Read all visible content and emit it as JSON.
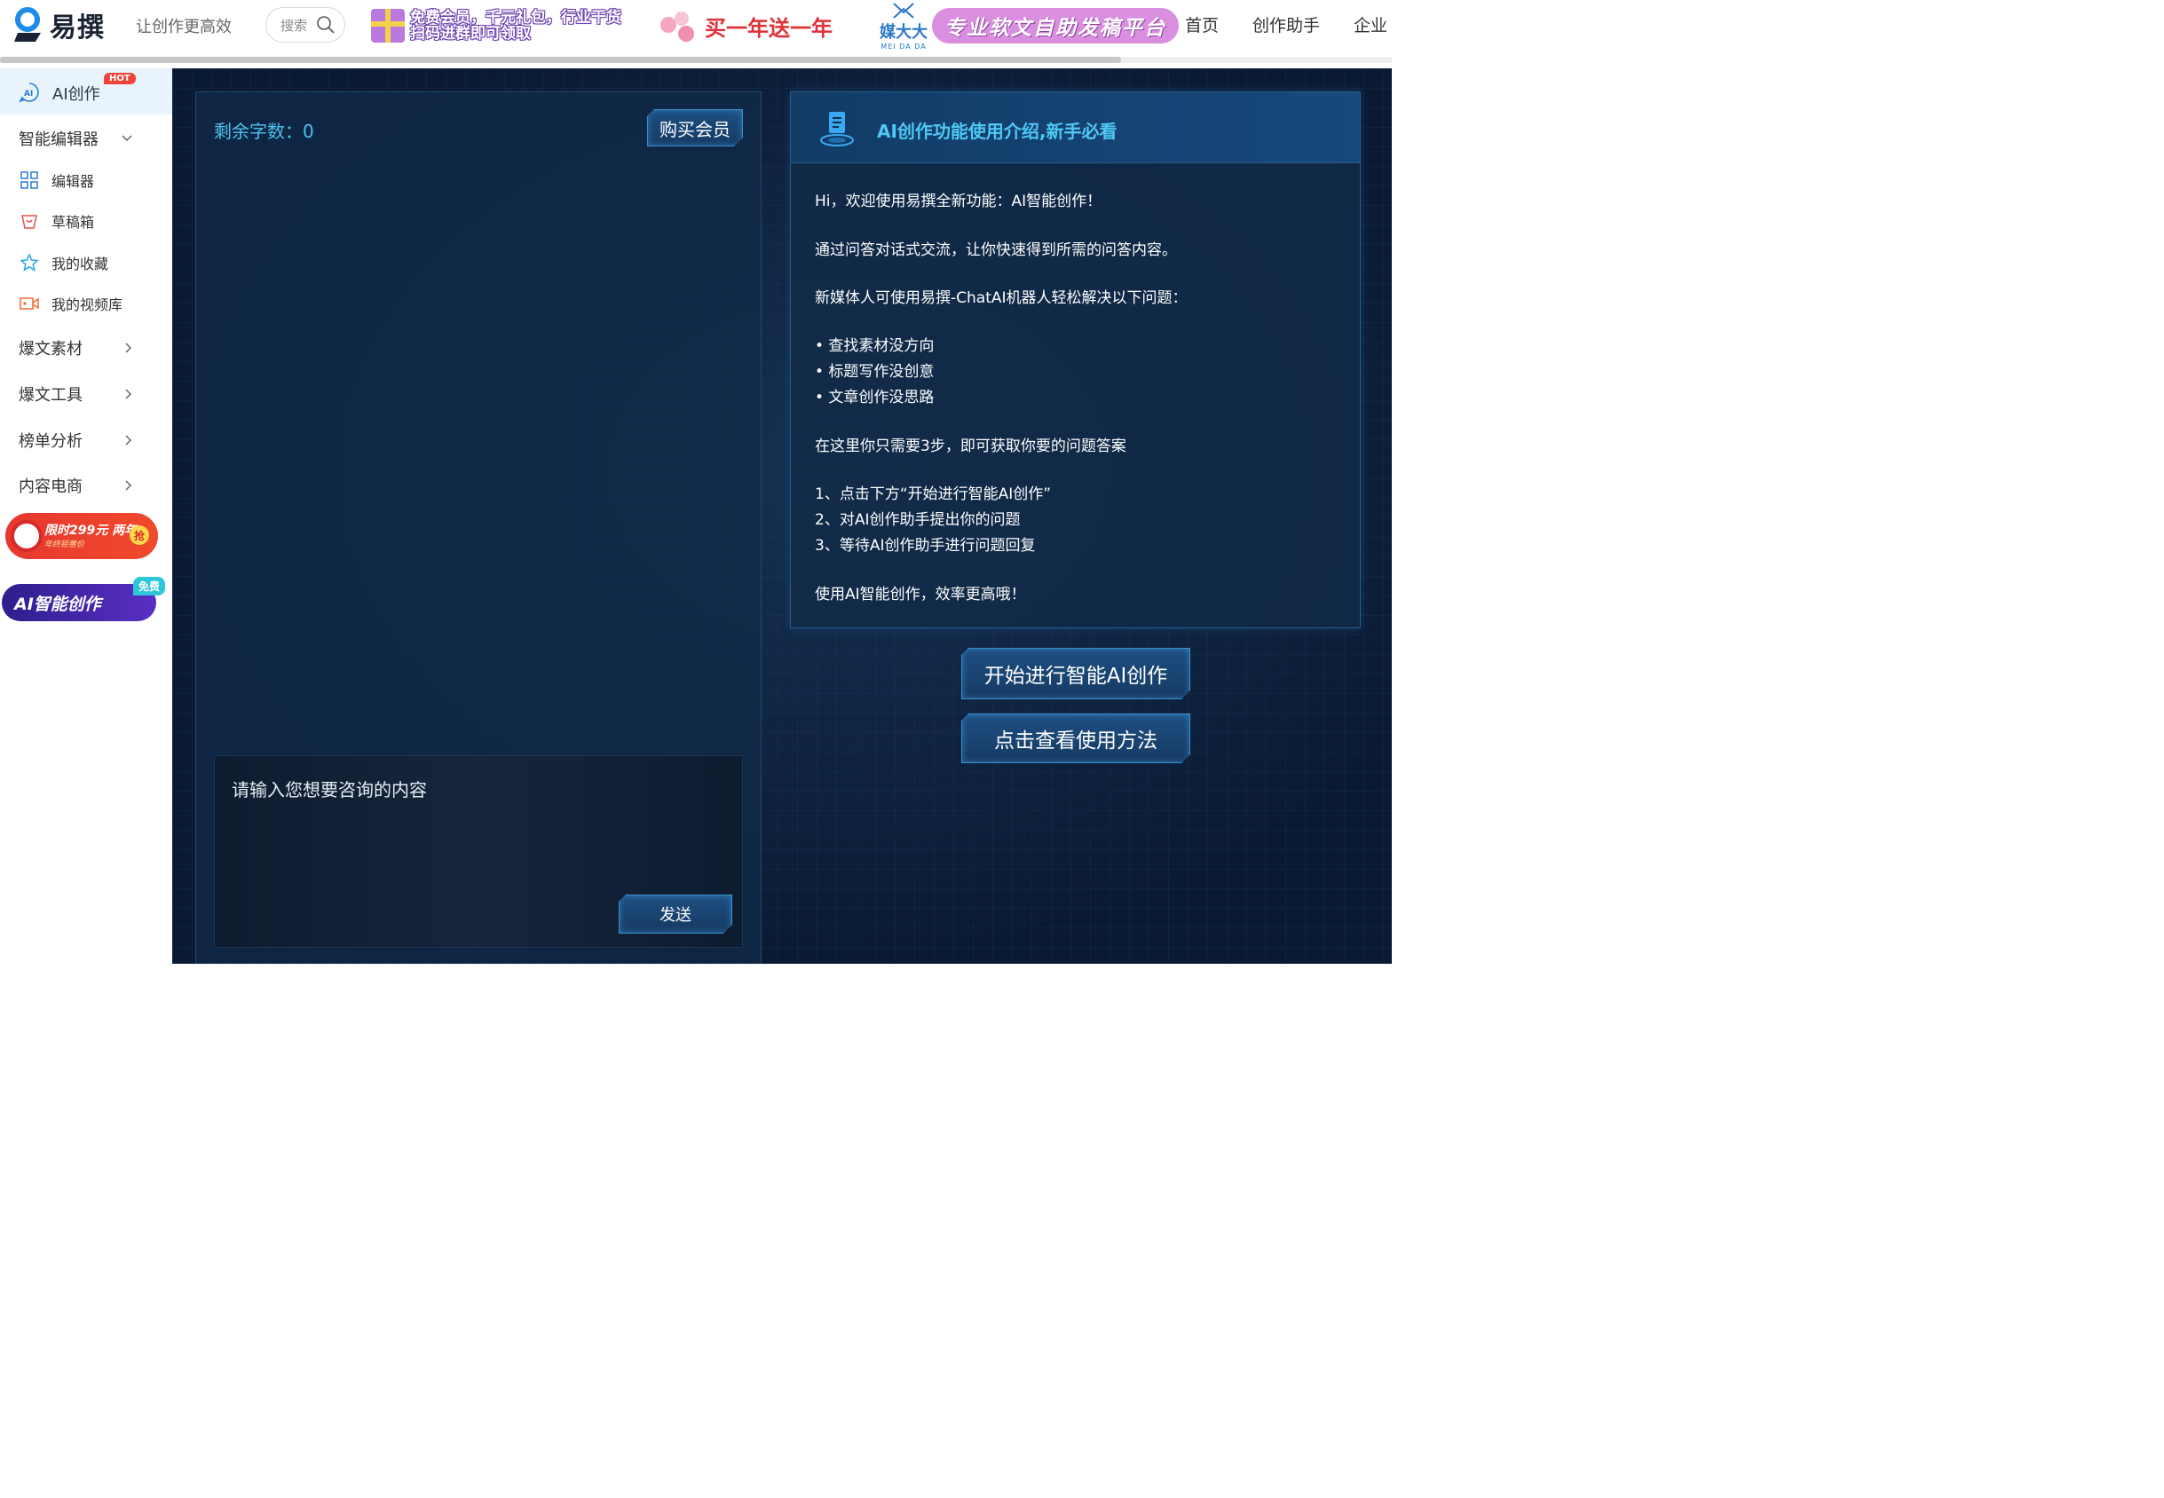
{
  "header": {
    "logo_text": "易撰",
    "slogan": "让创作更高效",
    "search_placeholder": "搜索",
    "banner_gift": [
      "免费会员，千元礼包，行业干货",
      "扫码进群即可领取"
    ],
    "banner_year": "买一年送一年",
    "banner_mdd_brand": "媒大大",
    "banner_mdd_sub": "MEI DA DA",
    "banner_mdd_text": "专业软文自助发稿平台",
    "nav": [
      "首页",
      "创作助手",
      "企业"
    ]
  },
  "sidebar": {
    "ai_create": "AI创作",
    "hot_badge": "HOT",
    "smart_editor": "智能编辑器",
    "sub_items": [
      "编辑器",
      "草稿箱",
      "我的收藏",
      "我的视频库"
    ],
    "groups": [
      "爆文素材",
      "爆文工具",
      "榜单分析",
      "内容电商"
    ],
    "promo1_line1": "限时299元 两年",
    "promo1_line2": "年终钜惠价",
    "promo1_badge": "抢",
    "promo2_text": "AI智能创作",
    "promo2_badge": "免费"
  },
  "chat": {
    "remaining_label": "剩余字数：0",
    "buy_button": "购买会员",
    "input_placeholder": "请输入您想要咨询的内容",
    "send_button": "发送"
  },
  "info": {
    "title": "AI创作功能使用介绍,新手必看",
    "lines": [
      "Hi，欢迎使用易撰全新功能：AI智能创作！",
      "通过问答对话式交流，让你快速得到所需的问答内容。",
      "新媒体人可使用易撰-ChatAI机器人轻松解决以下问题：",
      "• 查找素材没方向",
      "• 标题写作没创意",
      "• 文章创作没思路",
      "在这里你只需要3步，即可获取你要的问题答案",
      "1、点击下方“开始进行智能AI创作”",
      "2、对AI创作助手提出你的问题",
      "3、等待AI创作助手进行问题回复",
      "使用AI智能创作，效率更高哦！"
    ],
    "start_button": "开始进行智能AI创作",
    "how_button": "点击查看使用方法"
  },
  "colors": {
    "accent_cyan": "#4fc1f0",
    "panel_bg": "#0b1a33",
    "hot_red": "#f0433a"
  }
}
